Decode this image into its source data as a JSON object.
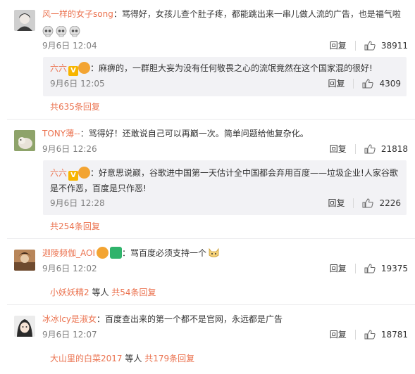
{
  "comments": [
    {
      "user": "风一样的女子song",
      "text": "：骂得好，女孩儿查个肚子疼，都能跳出来一串儿做人流的广告，也是福气啦",
      "emojis": [
        "skull-emoji",
        "skull-emoji",
        "skull-emoji"
      ],
      "time": "9月6日 12:04",
      "reply_label": "回复",
      "likes": "38911",
      "reply": {
        "user": "六六",
        "text": "：麻痹的，一群胆大妄为没有任何敬畏之心的流氓竟然在这个国家混的很好!",
        "time": "9月6日 12:05",
        "reply_label": "回复",
        "likes": "4309"
      },
      "more": "共635条回复"
    },
    {
      "user": "TONY薄--",
      "text": "：骂得好！还敢说自己可以再巅一次。简单问题给他复杂化。",
      "time": "9月6日 12:26",
      "reply_label": "回复",
      "likes": "21818",
      "reply": {
        "user": "六六",
        "text": "：好意思说巅，谷歌进中国第一天估计全中国都会弃用百度——垃圾企业!人家谷歌是不作恶，百度是只作恶!",
        "time": "9月6日 12:28",
        "reply_label": "回复",
        "likes": "2226"
      },
      "more": "共254条回复"
    },
    {
      "user": "迦陵频伽_AOI",
      "text": "：骂百度必须支持一个",
      "time": "9月6日 12:02",
      "reply_label": "回复",
      "likes": "19375",
      "more_user": "小妖妖精2",
      "more_mid": " 等人 ",
      "more": "共54条回复"
    },
    {
      "user": "冰冰lcy是淑女",
      "text": "：百度查出来的第一个都不是官网，永远都是广告",
      "time": "9月6日 12:07",
      "reply_label": "回复",
      "likes": "18781",
      "more_user": "大山里的白菜2017",
      "more_mid": " 等人 ",
      "more": "共179条回复"
    }
  ],
  "colors": {
    "link": "#eb7350",
    "reply_bg": "#f2f2f5",
    "badge": "#f7b500"
  }
}
